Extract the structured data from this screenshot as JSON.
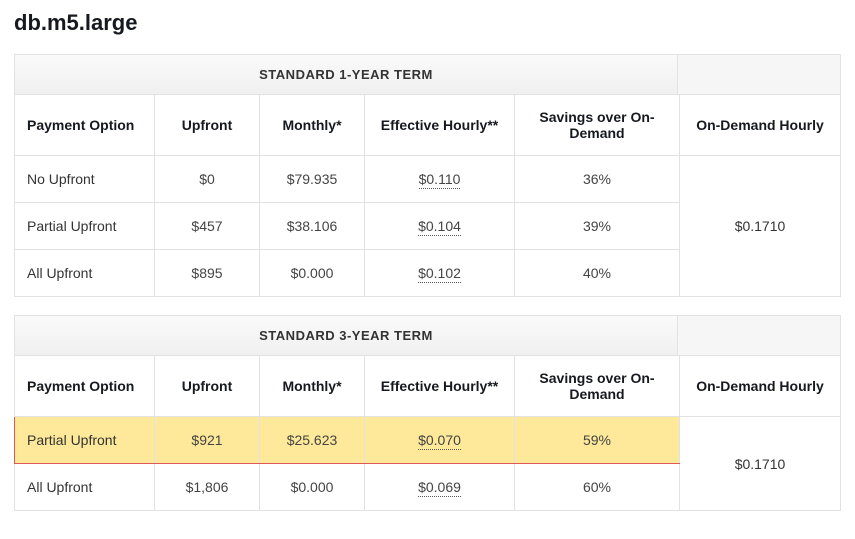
{
  "title": "db.m5.large",
  "headers": {
    "payment": "Payment Option",
    "upfront": "Upfront",
    "monthly": "Monthly*",
    "effective": "Effective Hourly**",
    "savings": "Savings over On-Demand",
    "ondemand": "On-Demand Hourly"
  },
  "terms": [
    {
      "title": "STANDARD 1-YEAR TERM",
      "ondemand": "$0.1710",
      "rows": [
        {
          "payment": "No Upfront",
          "upfront": "$0",
          "monthly": "$79.935",
          "effective": "$0.110",
          "savings": "36%",
          "highlight": false
        },
        {
          "payment": "Partial Upfront",
          "upfront": "$457",
          "monthly": "$38.106",
          "effective": "$0.104",
          "savings": "39%",
          "highlight": false
        },
        {
          "payment": "All Upfront",
          "upfront": "$895",
          "monthly": "$0.000",
          "effective": "$0.102",
          "savings": "40%",
          "highlight": false
        }
      ]
    },
    {
      "title": "STANDARD 3-YEAR TERM",
      "ondemand": "$0.1710",
      "rows": [
        {
          "payment": "Partial Upfront",
          "upfront": "$921",
          "monthly": "$25.623",
          "effective": "$0.070",
          "savings": "59%",
          "highlight": true
        },
        {
          "payment": "All Upfront",
          "upfront": "$1,806",
          "monthly": "$0.000",
          "effective": "$0.069",
          "savings": "60%",
          "highlight": false
        }
      ]
    }
  ]
}
